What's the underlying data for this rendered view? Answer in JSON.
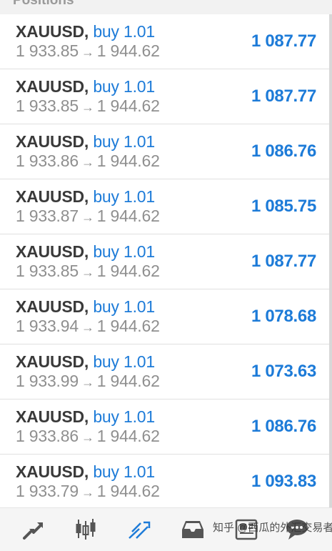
{
  "header": {
    "title": "Positions"
  },
  "positions": [
    {
      "symbol": "XAUUSD,",
      "direction": "buy",
      "volume": "1.01",
      "open_price": "1 933.85",
      "arrow": "→",
      "current_price": "1 944.62",
      "profit": "1 087.77"
    },
    {
      "symbol": "XAUUSD,",
      "direction": "buy",
      "volume": "1.01",
      "open_price": "1 933.85",
      "arrow": "→",
      "current_price": "1 944.62",
      "profit": "1 087.77"
    },
    {
      "symbol": "XAUUSD,",
      "direction": "buy",
      "volume": "1.01",
      "open_price": "1 933.86",
      "arrow": "→",
      "current_price": "1 944.62",
      "profit": "1 086.76"
    },
    {
      "symbol": "XAUUSD,",
      "direction": "buy",
      "volume": "1.01",
      "open_price": "1 933.87",
      "arrow": "→",
      "current_price": "1 944.62",
      "profit": "1 085.75"
    },
    {
      "symbol": "XAUUSD,",
      "direction": "buy",
      "volume": "1.01",
      "open_price": "1 933.85",
      "arrow": "→",
      "current_price": "1 944.62",
      "profit": "1 087.77"
    },
    {
      "symbol": "XAUUSD,",
      "direction": "buy",
      "volume": "1.01",
      "open_price": "1 933.94",
      "arrow": "→",
      "current_price": "1 944.62",
      "profit": "1 078.68"
    },
    {
      "symbol": "XAUUSD,",
      "direction": "buy",
      "volume": "1.01",
      "open_price": "1 933.99",
      "arrow": "→",
      "current_price": "1 944.62",
      "profit": "1 073.63"
    },
    {
      "symbol": "XAUUSD,",
      "direction": "buy",
      "volume": "1.01",
      "open_price": "1 933.86",
      "arrow": "→",
      "current_price": "1 944.62",
      "profit": "1 086.76"
    },
    {
      "symbol": "XAUUSD,",
      "direction": "buy",
      "volume": "1.01",
      "open_price": "1 933.79",
      "arrow": "→",
      "current_price": "1 944.62",
      "profit": "1 093.83"
    }
  ],
  "bottom_nav": [
    {
      "icon": "quotes-icon",
      "active": false
    },
    {
      "icon": "chart-candles-icon",
      "active": false
    },
    {
      "icon": "trade-icon",
      "active": true
    },
    {
      "icon": "history-inbox-icon",
      "active": false
    },
    {
      "icon": "news-icon",
      "active": false
    },
    {
      "icon": "messages-icon",
      "active": false
    }
  ],
  "watermark": "知乎 @西瓜的外汇交易者",
  "colors": {
    "accent": "#1d7bd8",
    "symbol": "#3a3a3a",
    "price": "#8f8f8f",
    "icon": "#555555"
  }
}
